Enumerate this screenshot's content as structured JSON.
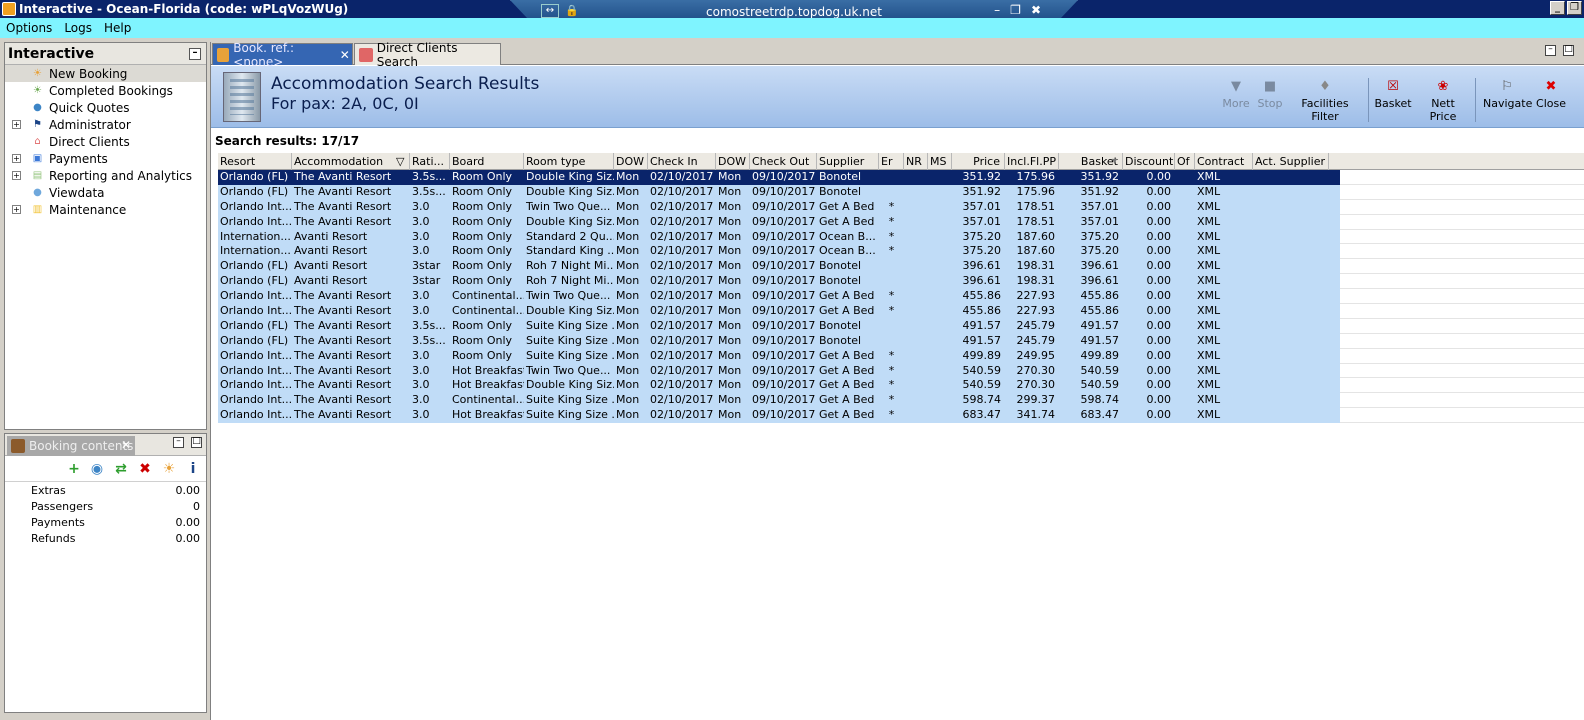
{
  "window": {
    "title": "Interactive - Ocean-Florida (code: wPLqVozWUg)",
    "min_icon": "minimize-icon",
    "restore_icon": "restore-icon"
  },
  "rdp": {
    "host": "comostreetrdp.topdog.uk.net",
    "pin_glyph": "↔",
    "lock_glyph": "🔒",
    "min_glyph": "–",
    "restore_glyph": "❐",
    "close_glyph": "✖"
  },
  "menu": [
    "Options",
    "Logs",
    "Help"
  ],
  "nav": {
    "title": "Interactive",
    "items": [
      {
        "label": "New Booking",
        "icon": "palm-tree-icon",
        "expandable": false,
        "selected": true,
        "color": "#e8a23a",
        "glyph": "☀"
      },
      {
        "label": "Completed Bookings",
        "icon": "palm-tree-icon",
        "expandable": false,
        "selected": false,
        "color": "#6aa84f",
        "glyph": "☀"
      },
      {
        "label": "Quick Quotes",
        "icon": "globe-icon",
        "expandable": false,
        "selected": false,
        "color": "#3d85c6",
        "glyph": "●"
      },
      {
        "label": "Administrator",
        "icon": "runner-icon",
        "expandable": true,
        "selected": false,
        "color": "#1c4587",
        "glyph": "⚑"
      },
      {
        "label": "Direct Clients",
        "icon": "house-icon",
        "expandable": false,
        "selected": false,
        "color": "#e06666",
        "glyph": "⌂"
      },
      {
        "label": "Payments",
        "icon": "monitor-icon",
        "expandable": true,
        "selected": false,
        "color": "#3c78d8",
        "glyph": "▣"
      },
      {
        "label": "Reporting and Analytics",
        "icon": "chart-icon",
        "expandable": true,
        "selected": false,
        "color": "#93c47d",
        "glyph": "▤"
      },
      {
        "label": "Viewdata",
        "icon": "globe-icon",
        "expandable": false,
        "selected": false,
        "color": "#6fa8dc",
        "glyph": "●"
      },
      {
        "label": "Maintenance",
        "icon": "books-icon",
        "expandable": true,
        "selected": false,
        "color": "#f1c232",
        "glyph": "▥"
      }
    ]
  },
  "booking": {
    "tab_label": "Booking contents",
    "rows": [
      {
        "label": "Extras",
        "value": "0.00"
      },
      {
        "label": "Passengers",
        "value": "0"
      },
      {
        "label": "Payments",
        "value": "0.00"
      },
      {
        "label": "Refunds",
        "value": "0.00"
      }
    ]
  },
  "tabs": [
    {
      "label": "Book. ref.: <none>",
      "active": true
    },
    {
      "label": "Direct Clients Search",
      "active": false
    }
  ],
  "banner": {
    "title": "Accommodation Search Results",
    "subtitle": "For pax: 2A, 0C, 0I"
  },
  "toolbar": [
    {
      "label": "More",
      "icon": "triangle-down-icon",
      "glyph": "▼",
      "disabled": true
    },
    {
      "label": "Stop",
      "icon": "stop-icon",
      "glyph": "■",
      "disabled": true
    },
    {
      "label": "Facilities Filter",
      "icon": "filter-icon",
      "glyph": "♦",
      "disabled": false
    },
    {
      "label": "Basket",
      "icon": "basket-icon",
      "glyph": "☒",
      "disabled": false
    },
    {
      "label": "Nett Price",
      "icon": "price-icon",
      "glyph": "❀",
      "disabled": false
    },
    {
      "label": "Navigate",
      "icon": "navigate-icon",
      "glyph": "⚐",
      "disabled": false
    },
    {
      "label": "Close",
      "icon": "close-icon",
      "glyph": "✖",
      "disabled": false
    }
  ],
  "results_count": "Search results: 17/17",
  "columns": [
    "Resort",
    "Accommodation",
    "Rati...",
    "Board",
    "Room type",
    "DOW",
    "Check In",
    "DOW",
    "Check Out",
    "Supplier",
    "Er",
    "NR",
    "MS",
    "Price",
    "Incl.Fl.PP",
    "Basket",
    "Discount",
    "Of",
    "Contract",
    "Act. Supplier"
  ],
  "rows": [
    [
      "Orlando (FL)",
      "The Avanti Resort",
      "3.5s...",
      "Room Only",
      "Double King Siz...",
      "Mon",
      "02/10/2017",
      "Mon",
      "09/10/2017",
      "Bonotel",
      "",
      "",
      "",
      "351.92",
      "175.96",
      "351.92",
      "0.00",
      "",
      "XML",
      ""
    ],
    [
      "Orlando (FL)",
      "The Avanti Resort",
      "3.5s...",
      "Room Only",
      "Double King Siz...",
      "Mon",
      "02/10/2017",
      "Mon",
      "09/10/2017",
      "Bonotel",
      "",
      "",
      "",
      "351.92",
      "175.96",
      "351.92",
      "0.00",
      "",
      "XML",
      ""
    ],
    [
      "Orlando Int...",
      "The Avanti Resort",
      "3.0",
      "Room Only",
      "Twin Two Que...",
      "Mon",
      "02/10/2017",
      "Mon",
      "09/10/2017",
      "Get A Bed",
      "*",
      "",
      "",
      "357.01",
      "178.51",
      "357.01",
      "0.00",
      "",
      "XML",
      ""
    ],
    [
      "Orlando Int...",
      "The Avanti Resort",
      "3.0",
      "Room Only",
      "Double King Siz...",
      "Mon",
      "02/10/2017",
      "Mon",
      "09/10/2017",
      "Get A Bed",
      "*",
      "",
      "",
      "357.01",
      "178.51",
      "357.01",
      "0.00",
      "",
      "XML",
      ""
    ],
    [
      "Internation...",
      "Avanti Resort",
      "3.0",
      "Room Only",
      "Standard 2 Qu...",
      "Mon",
      "02/10/2017",
      "Mon",
      "09/10/2017",
      "Ocean B...",
      "*",
      "",
      "",
      "375.20",
      "187.60",
      "375.20",
      "0.00",
      "",
      "XML",
      ""
    ],
    [
      "Internation...",
      "Avanti Resort",
      "3.0",
      "Room Only",
      "Standard King ...",
      "Mon",
      "02/10/2017",
      "Mon",
      "09/10/2017",
      "Ocean B...",
      "*",
      "",
      "",
      "375.20",
      "187.60",
      "375.20",
      "0.00",
      "",
      "XML",
      ""
    ],
    [
      "Orlando (FL)",
      "Avanti Resort",
      "3star",
      "Room Only",
      "Roh 7 Night Mi...",
      "Mon",
      "02/10/2017",
      "Mon",
      "09/10/2017",
      "Bonotel",
      "",
      "",
      "",
      "396.61",
      "198.31",
      "396.61",
      "0.00",
      "",
      "XML",
      ""
    ],
    [
      "Orlando (FL)",
      "Avanti Resort",
      "3star",
      "Room Only",
      "Roh 7 Night Mi...",
      "Mon",
      "02/10/2017",
      "Mon",
      "09/10/2017",
      "Bonotel",
      "",
      "",
      "",
      "396.61",
      "198.31",
      "396.61",
      "0.00",
      "",
      "XML",
      ""
    ],
    [
      "Orlando Int...",
      "The Avanti Resort",
      "3.0",
      "Continental...",
      "Twin Two Que...",
      "Mon",
      "02/10/2017",
      "Mon",
      "09/10/2017",
      "Get A Bed",
      "*",
      "",
      "",
      "455.86",
      "227.93",
      "455.86",
      "0.00",
      "",
      "XML",
      ""
    ],
    [
      "Orlando Int...",
      "The Avanti Resort",
      "3.0",
      "Continental...",
      "Double King Siz...",
      "Mon",
      "02/10/2017",
      "Mon",
      "09/10/2017",
      "Get A Bed",
      "*",
      "",
      "",
      "455.86",
      "227.93",
      "455.86",
      "0.00",
      "",
      "XML",
      ""
    ],
    [
      "Orlando (FL)",
      "The Avanti Resort",
      "3.5s...",
      "Room Only",
      "Suite King Size ...",
      "Mon",
      "02/10/2017",
      "Mon",
      "09/10/2017",
      "Bonotel",
      "",
      "",
      "",
      "491.57",
      "245.79",
      "491.57",
      "0.00",
      "",
      "XML",
      ""
    ],
    [
      "Orlando (FL)",
      "The Avanti Resort",
      "3.5s...",
      "Room Only",
      "Suite King Size ...",
      "Mon",
      "02/10/2017",
      "Mon",
      "09/10/2017",
      "Bonotel",
      "",
      "",
      "",
      "491.57",
      "245.79",
      "491.57",
      "0.00",
      "",
      "XML",
      ""
    ],
    [
      "Orlando Int...",
      "The Avanti Resort",
      "3.0",
      "Room Only",
      "Suite King Size ...",
      "Mon",
      "02/10/2017",
      "Mon",
      "09/10/2017",
      "Get A Bed",
      "*",
      "",
      "",
      "499.89",
      "249.95",
      "499.89",
      "0.00",
      "",
      "XML",
      ""
    ],
    [
      "Orlando Int...",
      "The Avanti Resort",
      "3.0",
      "Hot Breakfast",
      "Twin Two Que...",
      "Mon",
      "02/10/2017",
      "Mon",
      "09/10/2017",
      "Get A Bed",
      "*",
      "",
      "",
      "540.59",
      "270.30",
      "540.59",
      "0.00",
      "",
      "XML",
      ""
    ],
    [
      "Orlando Int...",
      "The Avanti Resort",
      "3.0",
      "Hot Breakfast",
      "Double King Siz...",
      "Mon",
      "02/10/2017",
      "Mon",
      "09/10/2017",
      "Get A Bed",
      "*",
      "",
      "",
      "540.59",
      "270.30",
      "540.59",
      "0.00",
      "",
      "XML",
      ""
    ],
    [
      "Orlando Int...",
      "The Avanti Resort",
      "3.0",
      "Continental...",
      "Suite King Size ...",
      "Mon",
      "02/10/2017",
      "Mon",
      "09/10/2017",
      "Get A Bed",
      "*",
      "",
      "",
      "598.74",
      "299.37",
      "598.74",
      "0.00",
      "",
      "XML",
      ""
    ],
    [
      "Orlando Int...",
      "The Avanti Resort",
      "3.0",
      "Hot Breakfast",
      "Suite King Size ...",
      "Mon",
      "02/10/2017",
      "Mon",
      "09/10/2017",
      "Get A Bed",
      "*",
      "",
      "",
      "683.47",
      "341.74",
      "683.47",
      "0.00",
      "",
      "XML",
      ""
    ]
  ]
}
